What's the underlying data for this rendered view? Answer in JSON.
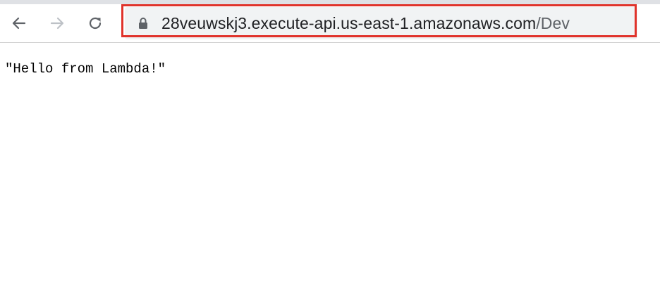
{
  "browser": {
    "url_host": "28veuwskj3.execute-api.us-east-1.amazonaws.com",
    "url_path": "/Dev",
    "icons": {
      "back": "arrow-left-icon",
      "forward": "arrow-right-icon",
      "reload": "reload-icon",
      "secure": "lock-icon"
    },
    "highlight_color": "#e0332b"
  },
  "page": {
    "body_text": "\"Hello from Lambda!\""
  }
}
